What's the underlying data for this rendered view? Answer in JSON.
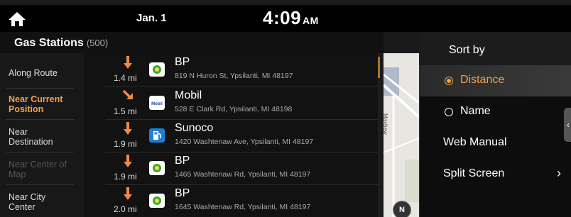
{
  "status_bar": {
    "date": "Jan. 1",
    "time": "4:09",
    "ampm": "AM"
  },
  "header": {
    "title": "Gas Stations",
    "count": "(500)"
  },
  "filters": [
    {
      "label": "Along Route",
      "state": "normal"
    },
    {
      "label": "Near Current Position",
      "state": "active"
    },
    {
      "label": "Near Destination",
      "state": "normal"
    },
    {
      "label": "Near Center of Map",
      "state": "disabled"
    },
    {
      "label": "Near City Center",
      "state": "normal"
    }
  ],
  "stations": [
    {
      "name": "BP",
      "address": "819 N Huron St, Ypsilanti, MI 48197",
      "distance": "1.4 mi",
      "direction": "down",
      "brand": "bp"
    },
    {
      "name": "Mobil",
      "address": "528 E Clark Rd, Ypsilanti, MI 48198",
      "distance": "1.5 mi",
      "direction": "down-right",
      "brand": "mobil"
    },
    {
      "name": "Sunoco",
      "address": "1420 Washtenaw Ave, Ypsilanti, MI 48197",
      "distance": "1.9 mi",
      "direction": "down",
      "brand": "sunoco"
    },
    {
      "name": "BP",
      "address": "1465 Washtenaw Rd, Ypsilanti, MI 48197",
      "distance": "1.9 mi",
      "direction": "down",
      "brand": "bp"
    },
    {
      "name": "BP",
      "address": "1645 Washtenaw Rd, Ypsilanti, MI 48197",
      "distance": "2.0 mi",
      "direction": "down",
      "brand": "bp"
    }
  ],
  "map": {
    "street_label": "Mayhew",
    "compass": "N"
  },
  "menu": {
    "sort_by": "Sort by",
    "options": [
      {
        "label": "Distance",
        "selected": true
      },
      {
        "label": "Name",
        "selected": false
      }
    ],
    "web_manual": "Web Manual",
    "split_screen": "Split Screen"
  },
  "colors": {
    "accent": "#f0a050",
    "bp_green": "#3aa83a",
    "sunoco_blue": "#1f7fd6"
  }
}
